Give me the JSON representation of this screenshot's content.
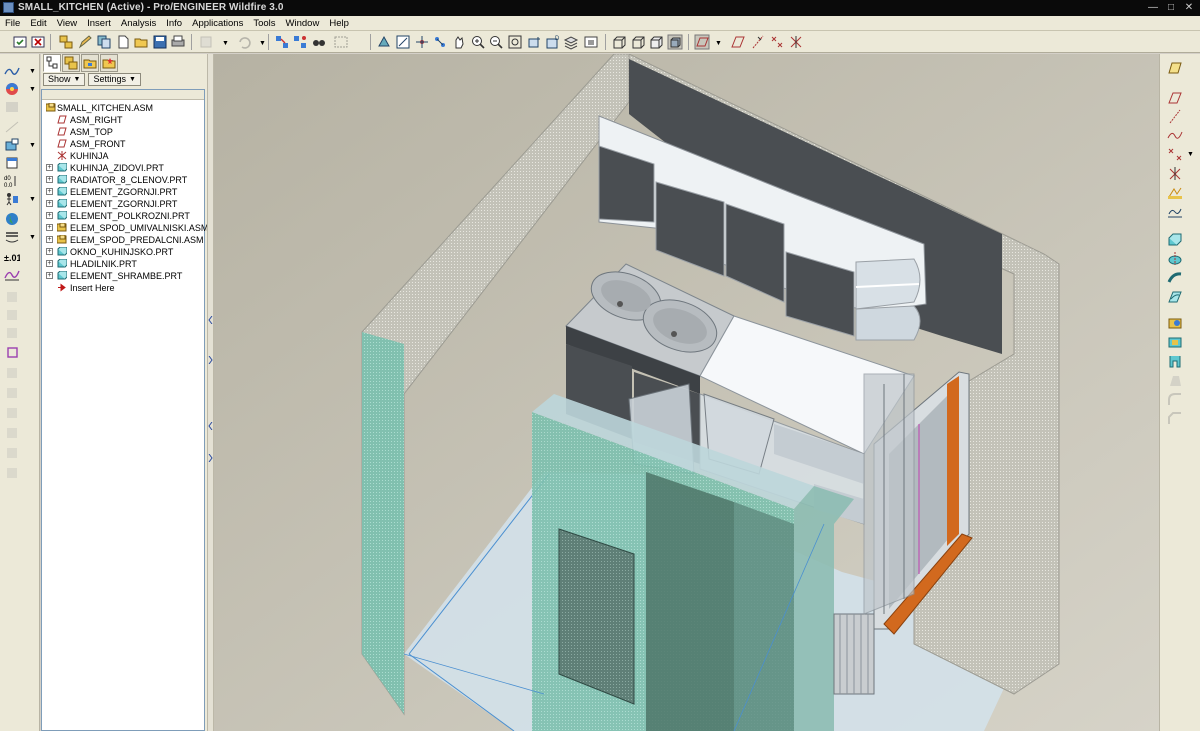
{
  "window": {
    "title": "SMALL_KITCHEN (Active) - Pro/ENGINEER Wildfire 3.0",
    "controls": [
      "minimize",
      "maximize",
      "close"
    ]
  },
  "menubar": {
    "items": [
      "File",
      "Edit",
      "View",
      "Insert",
      "Analysis",
      "Info",
      "Applications",
      "Tools",
      "Window",
      "Help"
    ]
  },
  "toolbar": {
    "icons": [
      "regenerate-icon",
      "close-window-icon",
      "model-tree-icon",
      "edit-definition-icon",
      "copy-icon",
      "new-file-icon",
      "open-file-icon",
      "save-icon",
      "print-icon",
      "cut-icon",
      "undo-icon",
      "regen-icon",
      "regen-manager-icon",
      "find-icon",
      "select-box-icon",
      "orient-icon",
      "repaint-icon",
      "spin-center-icon",
      "pan-icon",
      "zoom-in-icon",
      "zoom-out-icon",
      "refit-icon",
      "reorient-icon",
      "saved-views-icon",
      "layers-icon",
      "view-manager-icon",
      "wireframe-icon",
      "hidden-line-icon",
      "no-hidden-icon",
      "shading-icon",
      "datum-plane-display-icon",
      "datum-axis-display-icon",
      "datum-point-display-icon",
      "coordinate-system-display-icon"
    ]
  },
  "left_strip": {
    "icons": [
      "sketch-icon",
      "appearance-icon",
      "model-icon",
      "section-icon",
      "feature-icon",
      "relations-icon",
      "family-table-icon",
      "mapkey-icon",
      "earth-icon",
      "dimension-icon",
      "tolerance-icon",
      "analysis-icon"
    ]
  },
  "navigator": {
    "tabs": [
      "model-tree-tab",
      "layer-tree-tab",
      "folder-browser-tab",
      "favorites-tab"
    ],
    "show_label": "Show",
    "settings_label": "Settings",
    "tree": [
      {
        "label": "SMALL_KITCHEN.ASM",
        "kind": "assembly",
        "level": 0,
        "expandable": false
      },
      {
        "label": "ASM_RIGHT",
        "kind": "datum-plane",
        "level": 1,
        "expandable": false
      },
      {
        "label": "ASM_TOP",
        "kind": "datum-plane",
        "level": 1,
        "expandable": false
      },
      {
        "label": "ASM_FRONT",
        "kind": "datum-plane",
        "level": 1,
        "expandable": false
      },
      {
        "label": "KUHINJA",
        "kind": "coordinate-system",
        "level": 1,
        "expandable": false
      },
      {
        "label": "KUHINJA_ZIDOVI.PRT",
        "kind": "part",
        "level": 1,
        "expandable": true
      },
      {
        "label": "RADIATOR_8_CLENOV.PRT",
        "kind": "part",
        "level": 1,
        "expandable": true
      },
      {
        "label": "ELEMENT_ZGORNJI.PRT",
        "kind": "part",
        "level": 1,
        "expandable": true
      },
      {
        "label": "ELEMENT_ZGORNJI.PRT",
        "kind": "part",
        "level": 1,
        "expandable": true
      },
      {
        "label": "ELEMENT_POLKROZNI.PRT",
        "kind": "part",
        "level": 1,
        "expandable": true
      },
      {
        "label": "ELEM_SPOD_UMIVALNISKI.ASM",
        "kind": "assembly",
        "level": 1,
        "expandable": true
      },
      {
        "label": "ELEM_SPOD_PREDALCNI.ASM",
        "kind": "assembly",
        "level": 1,
        "expandable": true
      },
      {
        "label": "OKNO_KUHINJSKO.PRT",
        "kind": "part",
        "level": 1,
        "expandable": true
      },
      {
        "label": "HLADILNIK.PRT",
        "kind": "part",
        "level": 1,
        "expandable": true
      },
      {
        "label": "ELEMENT_SHRAMBE.PRT",
        "kind": "part",
        "level": 1,
        "expandable": true
      },
      {
        "label": "Insert Here",
        "kind": "insert-marker",
        "level": 1,
        "expandable": false
      }
    ]
  },
  "right_strip": {
    "icons": [
      "datum-plane-icon",
      "datum-plane-tool-icon",
      "datum-axis-icon",
      "datum-curve-icon",
      "datum-point-icon",
      "coordinate-system-icon",
      "analysis-feature-icon",
      "extrude-icon",
      "revolve-icon",
      "sweep-icon",
      "blend-icon",
      "hole-icon",
      "shell-icon",
      "rib-icon",
      "draft-icon",
      "round-icon",
      "chamfer-icon"
    ]
  },
  "colors": {
    "title_bg": "#0a0a0a",
    "chrome_bg": "#ece9d8",
    "viewport_bg": "#bcb8a9",
    "wall_gray": "#b9b8ae",
    "glass_teal": "#7fbfb0",
    "cabinet_dark": "#4a4e52",
    "countertop_white": "#f4f6f8",
    "window_sill_orange": "#d2691e"
  }
}
